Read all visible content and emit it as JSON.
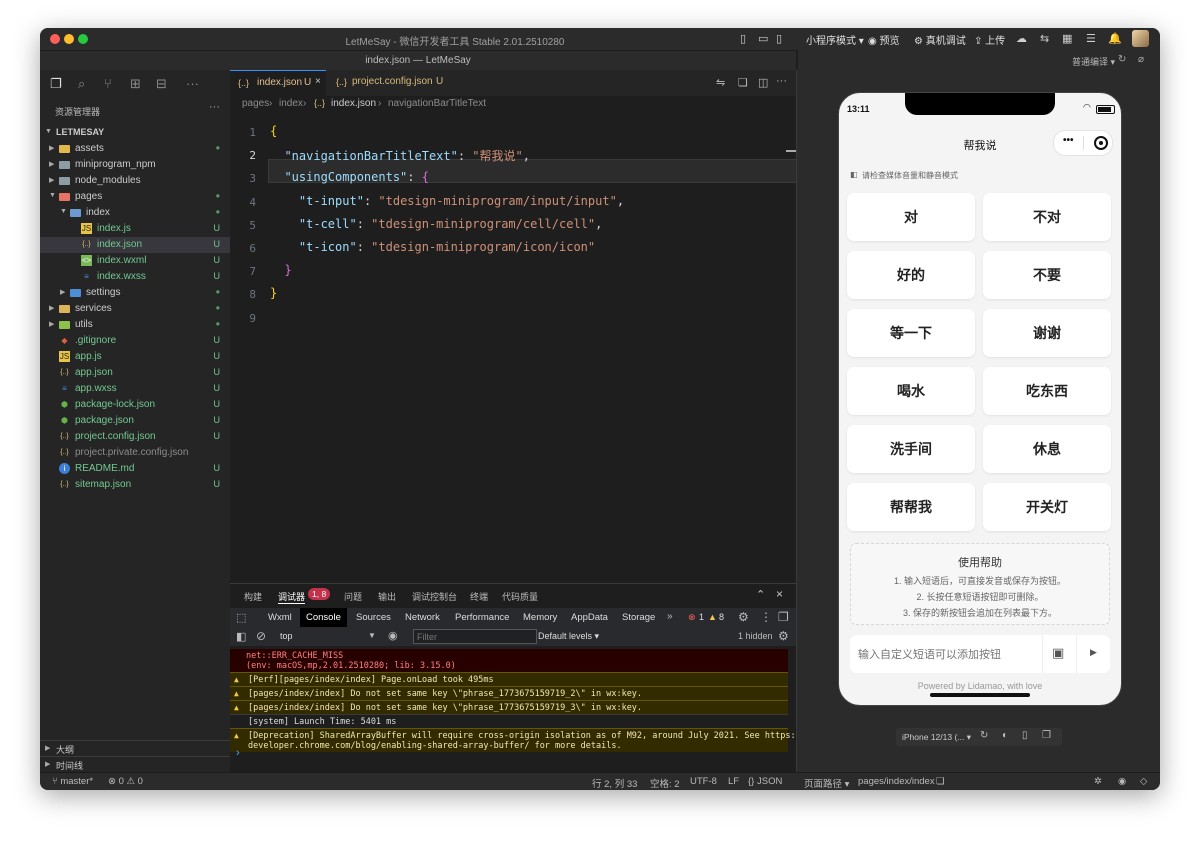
{
  "window": {
    "title": "LetMeSay - 微信开发者工具 Stable 2.01.2510280",
    "editor_title": "index.json — LetMeSay"
  },
  "toolbar": {
    "mode": "小程序模式 ▾",
    "preview": "预览",
    "device_debug": "真机调试",
    "upload": "上传"
  },
  "compile": {
    "label": "普通编译 ▾"
  },
  "explorer": {
    "header": "资源管理器",
    "project": "LETMESAY",
    "items": [
      {
        "name": "assets",
        "badge": "•"
      },
      {
        "name": "miniprogram_npm",
        "badge": ""
      },
      {
        "name": "node_modules",
        "badge": ""
      },
      {
        "name": "pages",
        "badge": "•"
      },
      {
        "name": "index",
        "badge": "•"
      },
      {
        "name": "index.js",
        "badge": "U"
      },
      {
        "name": "index.json",
        "badge": "U"
      },
      {
        "name": "index.wxml",
        "badge": "U"
      },
      {
        "name": "index.wxss",
        "badge": "U"
      },
      {
        "name": "settings",
        "badge": "•"
      },
      {
        "name": "services",
        "badge": "•"
      },
      {
        "name": "utils",
        "badge": "•"
      },
      {
        "name": ".gitignore",
        "badge": "U"
      },
      {
        "name": "app.js",
        "badge": "U"
      },
      {
        "name": "app.json",
        "badge": "U"
      },
      {
        "name": "app.wxss",
        "badge": "U"
      },
      {
        "name": "package-lock.json",
        "badge": "U"
      },
      {
        "name": "package.json",
        "badge": "U"
      },
      {
        "name": "project.config.json",
        "badge": "U"
      },
      {
        "name": "project.private.config.json",
        "badge": ""
      },
      {
        "name": "README.md",
        "badge": "U"
      },
      {
        "name": "sitemap.json",
        "badge": "U"
      }
    ],
    "outline": "大纲",
    "timeline": "时间线"
  },
  "tabs": [
    {
      "label": "index.json",
      "badge": "U"
    },
    {
      "label": "project.config.json",
      "badge": "U"
    }
  ],
  "breadcrumb": {
    "parts": [
      "pages",
      "index",
      "index.json",
      "navigationBarTitleText"
    ]
  },
  "code": {
    "lines": [
      "{",
      "  \"navigationBarTitleText\": \"帮我说\",",
      "  \"usingComponents\": {",
      "    \"t-input\": \"tdesign-miniprogram/input/input\",",
      "    \"t-cell\": \"tdesign-miniprogram/cell/cell\",",
      "    \"t-icon\": \"tdesign-miniprogram/icon/icon\"",
      "  }",
      "}",
      ""
    ]
  },
  "panel": {
    "tabs": [
      "构建",
      "调试器",
      "问题",
      "输出",
      "调试控制台",
      "终端",
      "代码质量"
    ],
    "debugger_badge": "1, 8",
    "devtools_tabs": [
      "Wxml",
      "Console",
      "Sources",
      "Network",
      "Performance",
      "Memory",
      "AppData",
      "Storage"
    ],
    "more": "»",
    "error_count": "1",
    "warn_count": "8",
    "context": "top",
    "filter_placeholder": "Filter",
    "levels": "Default levels ▾",
    "hidden": "1 hidden",
    "logs": [
      {
        "type": "err",
        "text": "net::ERR_CACHE_MISS\n(env: macOS,mp,2.01.2510280; lib: 3.15.0)"
      },
      {
        "type": "warn",
        "text": "[Perf][pages/index/index] Page.onLoad took 495ms"
      },
      {
        "type": "warn",
        "text": "[pages/index/index] Do not set same key \\\"phrase_1773675159719_2\\\" in wx:key."
      },
      {
        "type": "warn",
        "text": "[pages/index/index] Do not set same key \\\"phrase_1773675159719_3\\\" in wx:key."
      },
      {
        "type": "info",
        "text": "[system] Launch Time: 5401 ms"
      },
      {
        "type": "warn",
        "text": "[Deprecation] SharedArrayBuffer will require cross-origin isolation as of M92, around July 2021. See https://\ndeveloper.chrome.com/blog/enabling-shared-array-buffer/ for more details."
      }
    ],
    "prompt": "›"
  },
  "status": {
    "branch": "master*",
    "problems": "⊗ 0 ⚠ 0",
    "position": "行 2, 列 33",
    "spaces": "空格: 2",
    "encoding": "UTF-8",
    "eol": "LF",
    "language": "{} JSON",
    "page_path_label": "页面路径 ▾",
    "page_path": "pages/index/index"
  },
  "phone": {
    "time": "13:11",
    "nav_title": "帮我说",
    "notice": "请检查媒体音量和静音模式",
    "phrases": [
      "对",
      "不对",
      "好的",
      "不要",
      "等一下",
      "谢谢",
      "喝水",
      "吃东西",
      "洗手间",
      "休息",
      "帮帮我",
      "开关灯"
    ],
    "help_title": "使用帮助",
    "help_lines": [
      "1. 输入短语后，可直接发音或保存为按钮。",
      "2. 长按任意短语按钮即可删除。",
      "3. 保存的新按钮会追加在列表最下方。"
    ],
    "input_placeholder": "输入自定义短语可以添加按钮",
    "powered": "Powered by Lidamao, with love",
    "device": "iPhone 12/13 (... ▾"
  }
}
